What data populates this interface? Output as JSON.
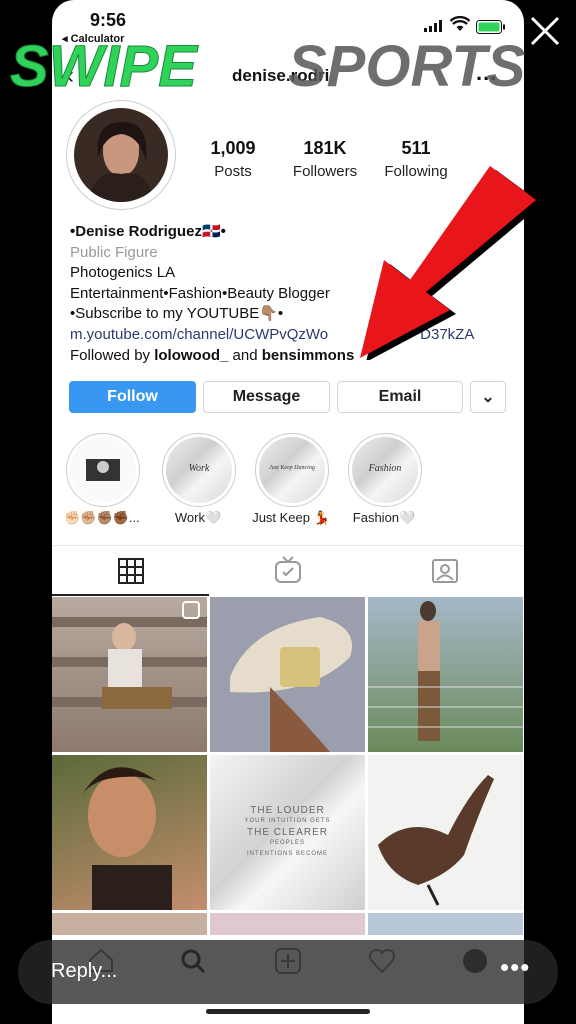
{
  "status": {
    "time": "9:56",
    "back_app": "◂ Calculator"
  },
  "brand": {
    "left": "SWIPE",
    "right": "SPORTS"
  },
  "nav": {
    "username": "denise.rodri",
    "more": "..."
  },
  "profile": {
    "stats": [
      {
        "value": "1,009",
        "label": "Posts"
      },
      {
        "value": "181K",
        "label": "Followers"
      },
      {
        "value": "511",
        "label": "Following"
      }
    ],
    "name": "•Denise Rodriguez🇩🇴•",
    "category": "Public Figure",
    "bio_lines": [
      "Photogenics LA",
      "Entertainment•Fashion•Beauty Blogger",
      "•Subscribe to my YOUTUBE👇🏽•"
    ],
    "link": "m.youtube.com/channel/UCWPvQzWo",
    "link_tail": "D37kZA",
    "followed_prefix": "Followed by ",
    "followed_a": "lolowood_",
    "followed_and": " and ",
    "followed_b": "bensimmons"
  },
  "actions": {
    "follow": "Follow",
    "message": "Message",
    "email": "Email",
    "more": "⌄"
  },
  "highlights": [
    {
      "label": "✊🏻✊🏼✊🏽✊🏾..."
    },
    {
      "label": "Work🤍",
      "inner": "Work"
    },
    {
      "label": "Just Keep 💃",
      "inner": "Just Keep Dancing"
    },
    {
      "label": "Fashion🤍",
      "inner": "Fashion"
    }
  ],
  "post_quote": {
    "l1": "THE LOUDER",
    "l2": "YOUR INTUITION GETS",
    "l3": "THE CLEARER",
    "l4": "PEOPLES",
    "l5": "INTENTIONS BECOME"
  },
  "reply": {
    "placeholder": "Reply...",
    "more": "•••"
  },
  "colors": {
    "follow_blue": "#3897f0",
    "brand_green": "#2fd35a",
    "arrow_red": "#e8161a"
  }
}
